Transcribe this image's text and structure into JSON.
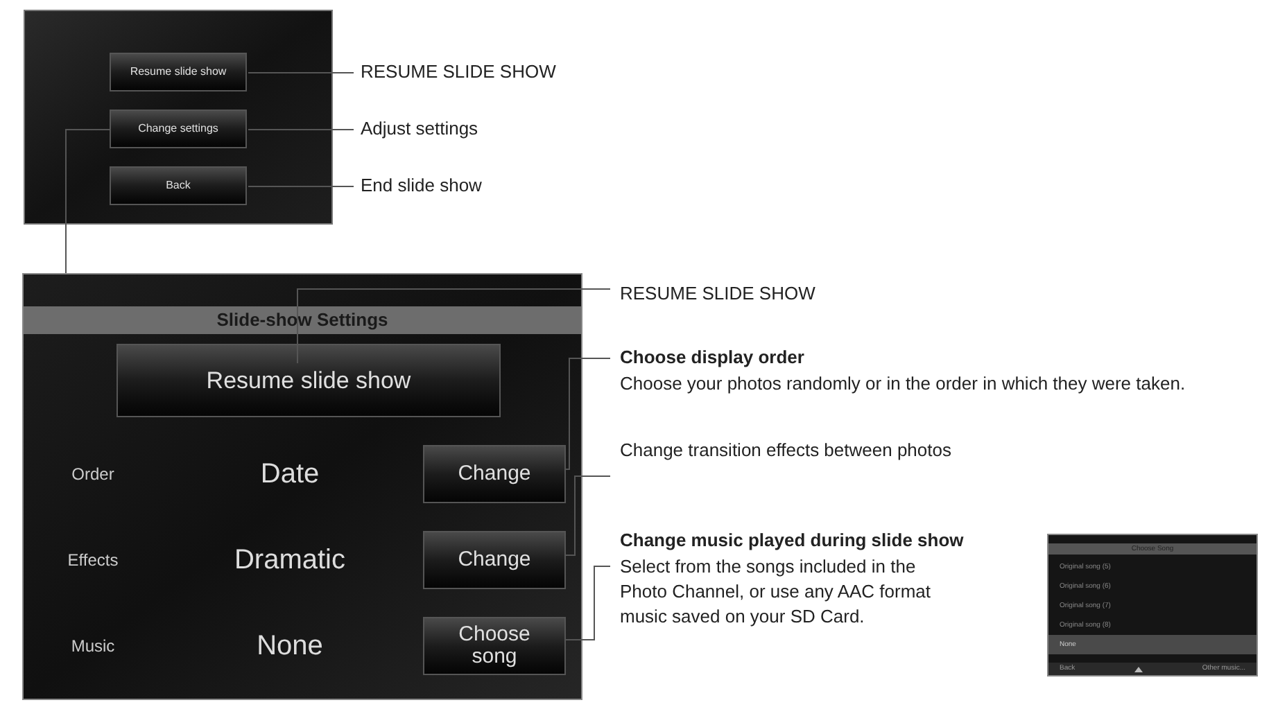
{
  "menu_screen": {
    "buttons": [
      "Resume slide show",
      "Change settings",
      "Back"
    ]
  },
  "menu_callouts": [
    "RESUME SLIDE SHOW",
    "Adjust settings",
    "End slide show"
  ],
  "settings_screen": {
    "title": "Slide-show Settings",
    "resume_button": "Resume slide show",
    "rows": [
      {
        "label": "Order",
        "value": "Date",
        "button": "Change"
      },
      {
        "label": "Effects",
        "value": "Dramatic",
        "button": "Change"
      },
      {
        "label": "Music",
        "value": "None",
        "button": "Choose song"
      }
    ]
  },
  "settings_callouts": [
    {
      "text": "RESUME SLIDE SHOW"
    },
    {
      "heading": "Choose display order",
      "text": "Choose your photos randomly or in the order in which they were taken."
    },
    {
      "text": "Change transition effects between photos"
    },
    {
      "heading": "Change music played during slide show",
      "text": "Select from the songs included in the Photo Channel, or use any AAC format music saved on your SD Card."
    }
  ],
  "song_screen": {
    "title": "Choose Song",
    "items": [
      {
        "label": "Original song (5)",
        "selected": false
      },
      {
        "label": "Original song (6)",
        "selected": false
      },
      {
        "label": "Original song (7)",
        "selected": false
      },
      {
        "label": "Original song (8)",
        "selected": false
      },
      {
        "label": "None",
        "selected": true
      }
    ],
    "back_button": "Back",
    "other_button": "Other music..."
  }
}
